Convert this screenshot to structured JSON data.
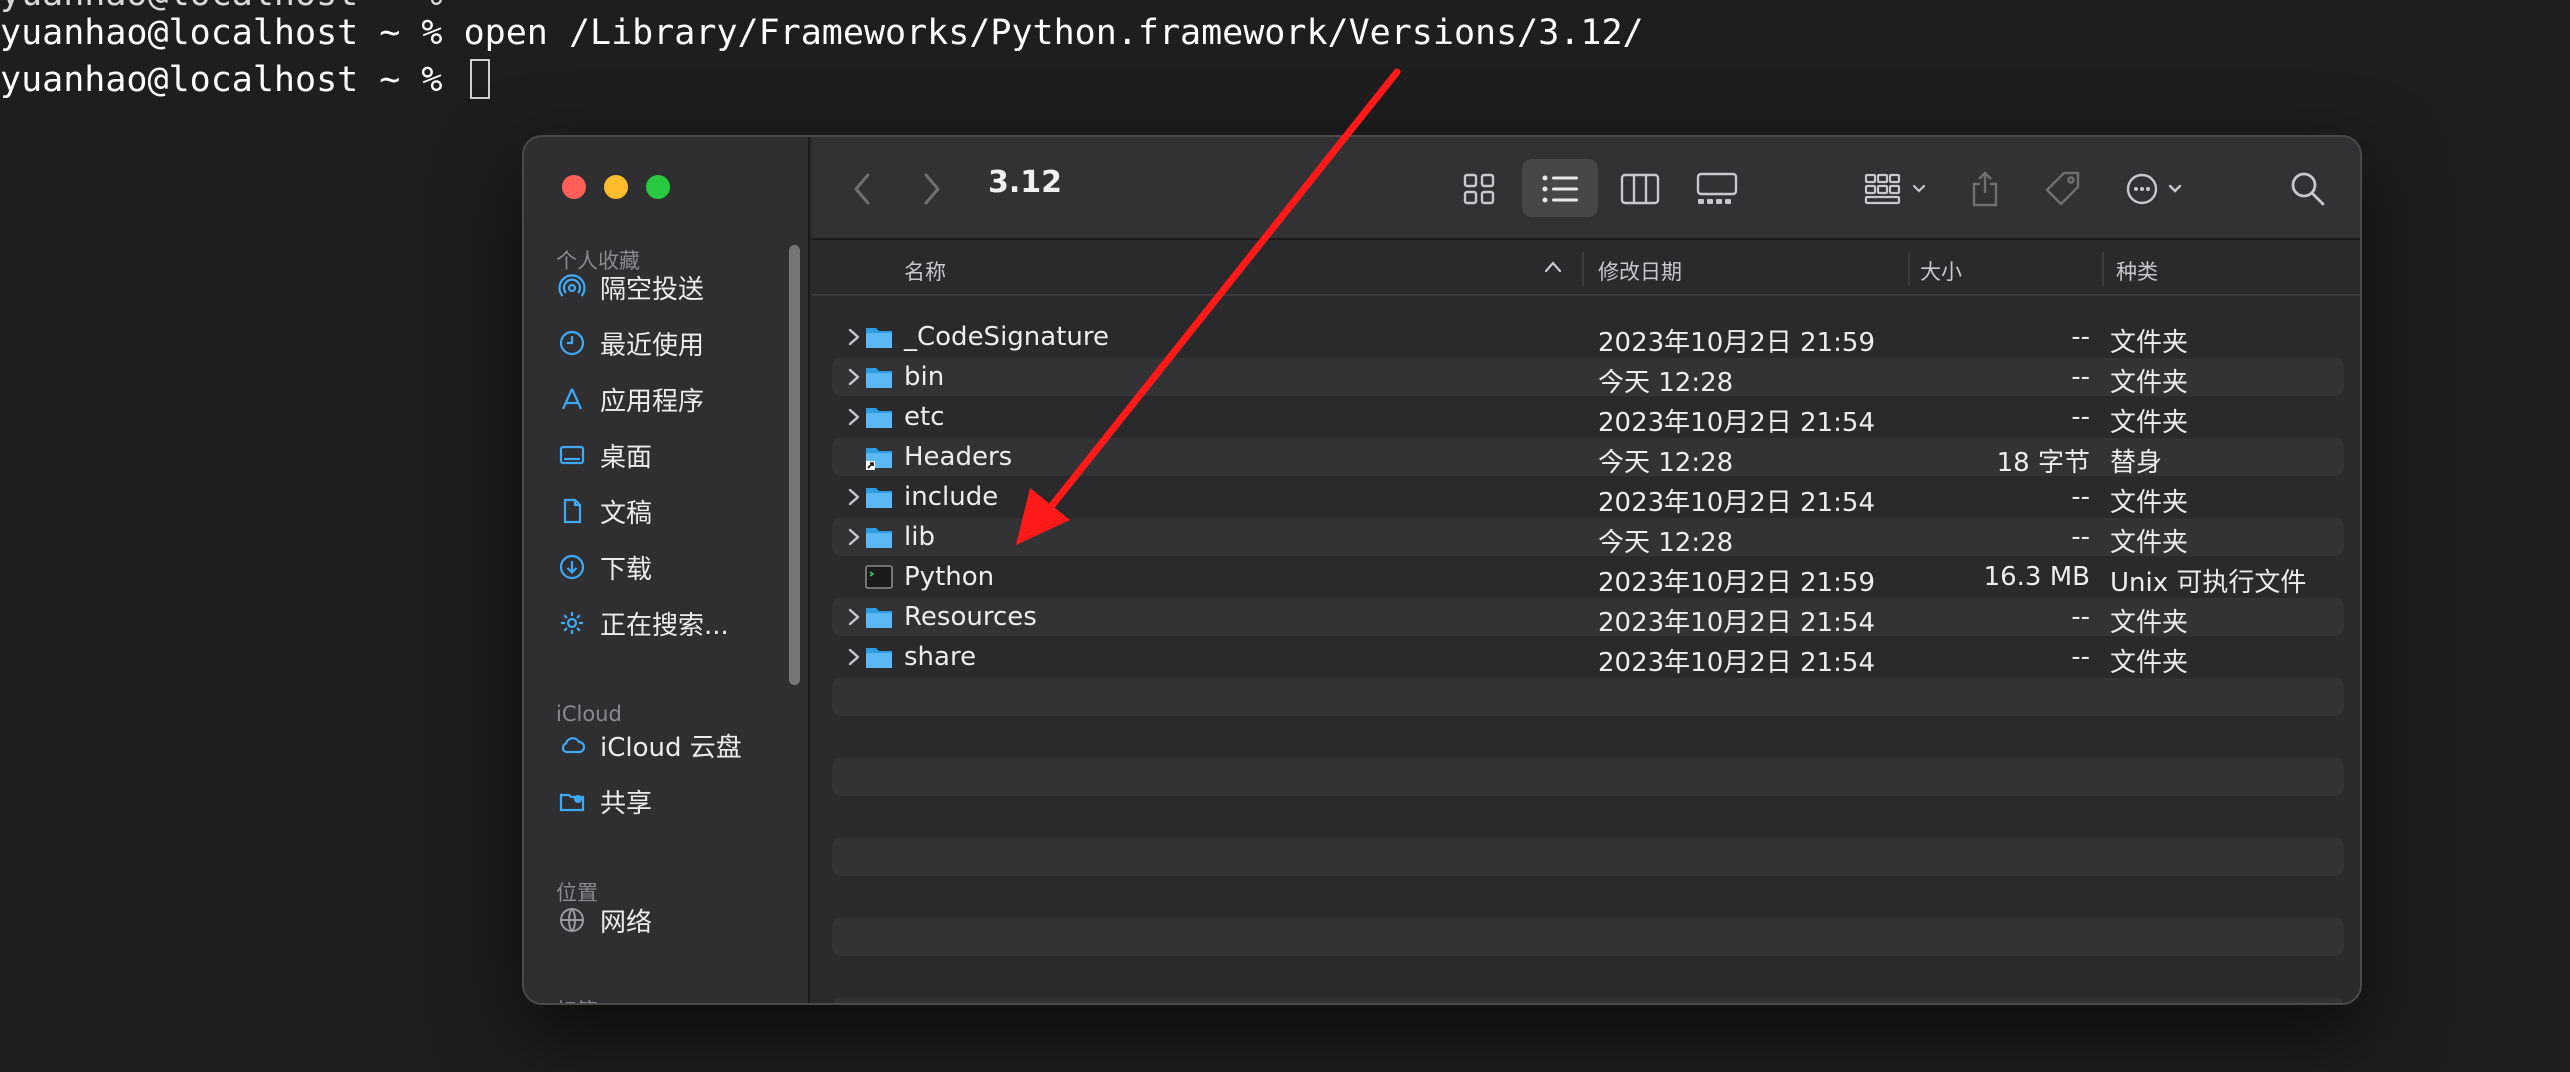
{
  "terminal": {
    "line0": "yuanhao@localhost ~ %",
    "line1": "yuanhao@localhost ~ % open /Library/Frameworks/Python.framework/Versions/3.12/",
    "line2": "yuanhao@localhost ~ % "
  },
  "finder": {
    "title": "3.12",
    "sidebar": {
      "favorites_header": "个人收藏",
      "favorites": [
        {
          "label": "隔空投送",
          "icon": "airdrop-icon"
        },
        {
          "label": "最近使用",
          "icon": "clock-icon"
        },
        {
          "label": "应用程序",
          "icon": "applications-icon"
        },
        {
          "label": "桌面",
          "icon": "desktop-icon"
        },
        {
          "label": "文稿",
          "icon": "document-icon"
        },
        {
          "label": "下载",
          "icon": "download-icon"
        },
        {
          "label": "正在搜索...",
          "icon": "gear-icon"
        }
      ],
      "icloud_header": "iCloud",
      "icloud": [
        {
          "label": "iCloud 云盘",
          "icon": "cloud-icon"
        },
        {
          "label": "共享",
          "icon": "shared-folder-icon"
        }
      ],
      "locations_header": "位置",
      "locations": [
        {
          "label": "网络",
          "icon": "network-icon"
        }
      ],
      "tags_header": "标签"
    },
    "columns": {
      "name": "名称",
      "date": "修改日期",
      "size": "大小",
      "kind": "种类"
    },
    "rows": [
      {
        "name": "_CodeSignature",
        "date": "2023年10月2日 21:59",
        "size": "--",
        "kind": "文件夹",
        "type": "folder"
      },
      {
        "name": "bin",
        "date": "今天 12:28",
        "size": "--",
        "kind": "文件夹",
        "type": "folder"
      },
      {
        "name": "etc",
        "date": "2023年10月2日 21:54",
        "size": "--",
        "kind": "文件夹",
        "type": "folder"
      },
      {
        "name": "Headers",
        "date": "今天 12:28",
        "size": "18 字节",
        "kind": "替身",
        "type": "alias"
      },
      {
        "name": "include",
        "date": "2023年10月2日 21:54",
        "size": "--",
        "kind": "文件夹",
        "type": "folder"
      },
      {
        "name": "lib",
        "date": "今天 12:28",
        "size": "--",
        "kind": "文件夹",
        "type": "folder"
      },
      {
        "name": "Python",
        "date": "2023年10月2日 21:59",
        "size": "16.3 MB",
        "kind": "Unix 可执行文件",
        "type": "exec"
      },
      {
        "name": "Resources",
        "date": "2023年10月2日 21:54",
        "size": "--",
        "kind": "文件夹",
        "type": "folder"
      },
      {
        "name": "share",
        "date": "2023年10月2日 21:54",
        "size": "--",
        "kind": "文件夹",
        "type": "folder"
      }
    ]
  },
  "colors": {
    "accent": "#3fa9f5",
    "annotation_arrow": "#ff1a1a"
  }
}
